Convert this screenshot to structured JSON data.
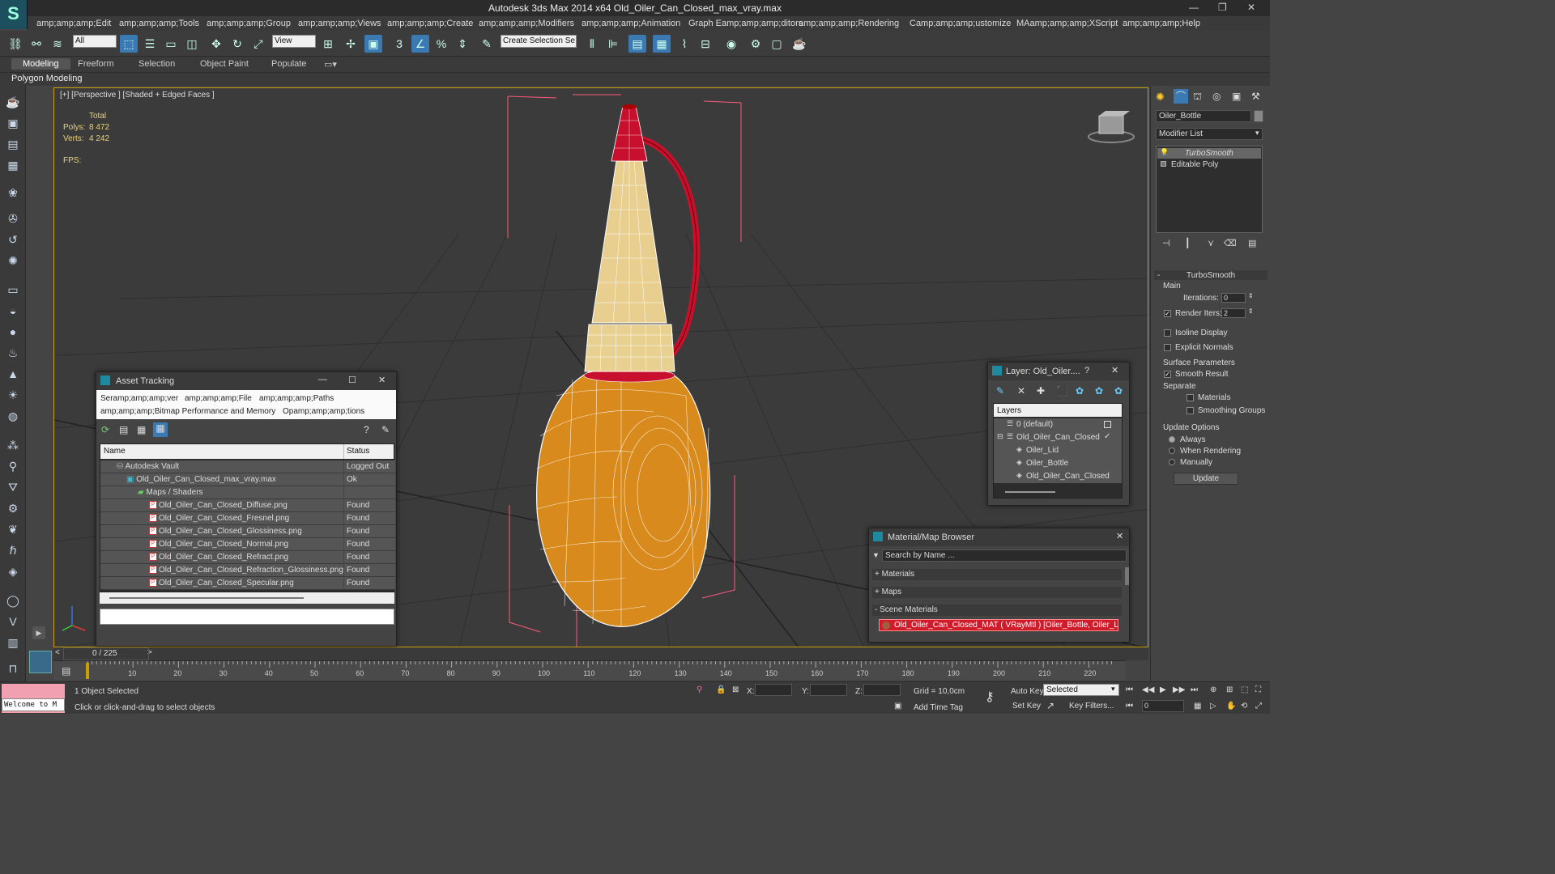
{
  "app": {
    "title": "Autodesk 3ds Max  2014 x64     Old_Oiler_Can_Closed_max_vray.max"
  },
  "menu": [
    "amp;amp;amp;Edit",
    "amp;amp;amp;Tools",
    "amp;amp;amp;Group",
    "amp;amp;amp;Views",
    "amp;amp;amp;Create",
    "amp;amp;amp;Modifiers",
    "amp;amp;amp;Animation",
    "Graph Eamp;amp;amp;ditors",
    "amp;amp;amp;Rendering",
    "Camp;amp;amp;ustomize",
    "MAamp;amp;amp;XScript",
    "amp;amp;amp;Help"
  ],
  "toolbar": {
    "filter": "All",
    "refcoord": "View",
    "selset": "Create Selection Se"
  },
  "ribbon": {
    "tabs": [
      "Modeling",
      "Freeform",
      "Selection",
      "Object Paint",
      "Populate"
    ],
    "panel": "Polygon Modeling"
  },
  "viewport": {
    "label": "[+] [Perspective ] [Shaded + Edged Faces ]",
    "total": "Total",
    "polys_label": "Polys:",
    "polys": "8 472",
    "verts_label": "Verts:",
    "verts": "4 242",
    "fps_label": "FPS:"
  },
  "command_panel": {
    "object_name": "Oiler_Bottle",
    "modifier_list": "Modifier List",
    "stack": [
      "TurboSmooth",
      "Editable Poly"
    ],
    "rollout": "TurboSmooth",
    "main": "Main",
    "iterations_label": "Iterations:",
    "iterations": "0",
    "render_iters_label": "Render Iters:",
    "render_iters": "2",
    "isoline": "Isoline Display",
    "explicit": "Explicit Normals",
    "surface": "Surface Parameters",
    "smooth_result": "Smooth Result",
    "separate": "Separate",
    "materials": "Materials",
    "smoothing_groups": "Smoothing Groups",
    "update_options": "Update Options",
    "always": "Always",
    "when_rendering": "When Rendering",
    "manually": "Manually",
    "update": "Update"
  },
  "asset_tracking": {
    "title": "Asset Tracking",
    "menus": [
      "Seramp;amp;amp;ver",
      "amp;amp;amp;File",
      "amp;amp;amp;Paths",
      "amp;amp;amp;Bitmap Performance and Memory",
      "Opamp;amp;amp;tions"
    ],
    "col_name": "Name",
    "col_status": "Status",
    "rows": [
      {
        "name": "Autodesk Vault",
        "status": "Logged Out .."
      },
      {
        "name": "Old_Oiler_Can_Closed_max_vray.max",
        "status": "Ok"
      },
      {
        "name": "Maps / Shaders",
        "status": ""
      },
      {
        "name": "Old_Oiler_Can_Closed_Diffuse.png",
        "status": "Found"
      },
      {
        "name": "Old_Oiler_Can_Closed_Fresnel.png",
        "status": "Found"
      },
      {
        "name": "Old_Oiler_Can_Closed_Glossiness.png",
        "status": "Found"
      },
      {
        "name": "Old_Oiler_Can_Closed_Normal.png",
        "status": "Found"
      },
      {
        "name": "Old_Oiler_Can_Closed_Refract.png",
        "status": "Found"
      },
      {
        "name": "Old_Oiler_Can_Closed_Refraction_Glossiness.png",
        "status": "Found"
      },
      {
        "name": "Old_Oiler_Can_Closed_Specular.png",
        "status": "Found"
      }
    ]
  },
  "layer": {
    "title": "Layer: Old_Oiler....",
    "help": "?",
    "header": "Layers",
    "items": [
      "0 (default)",
      "Old_Oiler_Can_Closed",
      "Oiler_Lid",
      "Oiler_Bottle",
      "Old_Oiler_Can_Closed"
    ]
  },
  "material_browser": {
    "title": "Material/Map Browser",
    "search": "Search by Name ...",
    "materials": "+ Materials",
    "maps": "+ Maps",
    "scene": "- Scene Materials",
    "scene_item": "Old_Oiler_Can_Closed_MAT ( VRayMtl ) [Oiler_Bottle, Oiler_Lid]"
  },
  "timeline": {
    "frame": "0 / 225",
    "ticks": [
      "10",
      "20",
      "30",
      "40",
      "50",
      "60",
      "70",
      "80",
      "90",
      "100",
      "110",
      "120",
      "130",
      "140",
      "150",
      "160",
      "170",
      "180",
      "190",
      "200",
      "210",
      "220"
    ]
  },
  "status": {
    "welcome": "Welcome to M",
    "selected": "1 Object Selected",
    "prompt": "Click or click-and-drag to select objects",
    "x": "X:",
    "y": "Y:",
    "z": "Z:",
    "grid": "Grid = 10,0cm",
    "autokey": "Auto Key",
    "selected_dd": "Selected",
    "setkey": "Set Key",
    "keyfilters": "Key Filters...",
    "addtimetag": "Add Time Tag",
    "frame_field": "0"
  },
  "colors": {
    "accent": "#3b79b3",
    "bottle": "#d98a1c",
    "cap": "#c8102e",
    "wire": "#ffffff",
    "selection": "#ff5577",
    "viewport_border": "#c8a000"
  }
}
